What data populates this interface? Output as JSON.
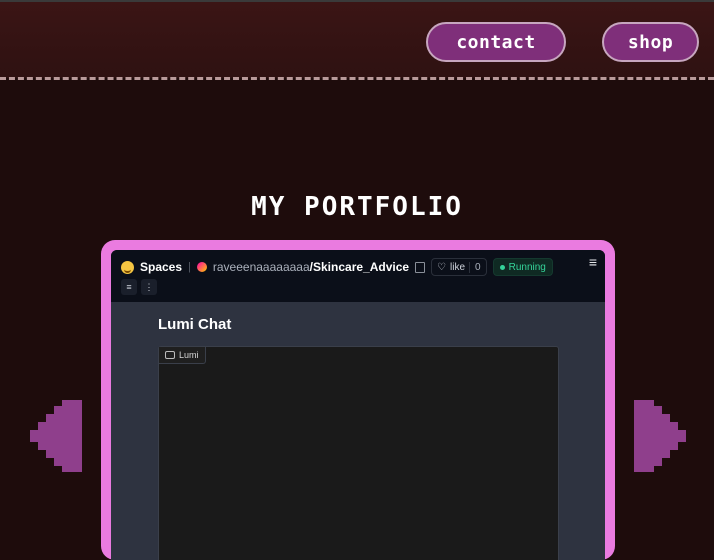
{
  "nav": {
    "contact_label": "contact",
    "shop_label": "shop"
  },
  "section": {
    "title": "MY PORTFOLIO"
  },
  "embed": {
    "spaces_label": "Spaces",
    "user": "raveeenaaaaaaaa",
    "separator": "/",
    "repo": "Skincare_Advice",
    "like_label": "like",
    "like_count": "0",
    "status": "Running",
    "app_title": "Lumi Chat",
    "chat_label": "Lumi"
  },
  "colors": {
    "background": "#1e0c0c",
    "header": "#3b1515",
    "button": "#7f2f7a",
    "frame": "#ea7be0",
    "arrow": "#8f3f8c",
    "status": "#34d399"
  },
  "icons": {
    "prev": "pixel-arrow-left-icon",
    "next": "pixel-arrow-right-icon",
    "hf": "hugging-face-emoji-icon",
    "heart": "heart-icon",
    "menu": "hamburger-menu-icon"
  }
}
